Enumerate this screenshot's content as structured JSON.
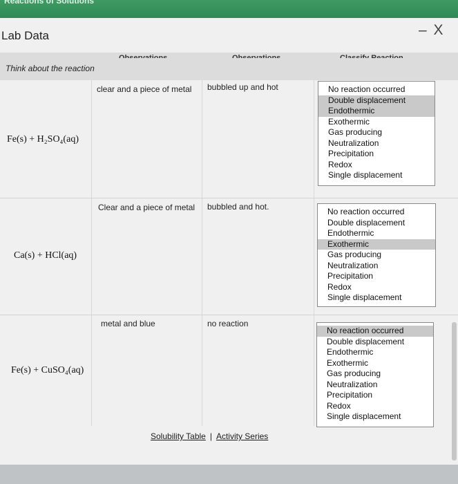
{
  "top_banner": "Reactions of Solutions",
  "window": {
    "title": "Lab Data",
    "close_label": "– X"
  },
  "headers": {
    "obs1": "Observations",
    "obs2": "Observations",
    "classify": "Classify Reaction",
    "think": "Think about the reaction"
  },
  "rows": [
    {
      "reaction": "Fe(s) + H₂SO₄(aq)",
      "obs1": "clear and a piece of metal",
      "obs2": "bubbled up and hot",
      "options": [
        "No reaction occurred",
        "Double displacement",
        "Endothermic",
        "Exothermic",
        "Gas producing",
        "Neutralization",
        "Precipitation",
        "Redox",
        "Single displacement"
      ],
      "selected": [
        "Double displacement",
        "Endothermic"
      ]
    },
    {
      "reaction": "Ca(s) + HCl(aq)",
      "obs1": "Clear and a piece of metal",
      "obs2": "bubbled and hot.",
      "options": [
        "No reaction occurred",
        "Double displacement",
        "Endothermic",
        "Exothermic",
        "Gas producing",
        "Neutralization",
        "Precipitation",
        "Redox",
        "Single displacement"
      ],
      "selected": [
        "Exothermic"
      ]
    },
    {
      "reaction": "Fe(s) + CuSO₄(aq)",
      "obs1": "metal and blue",
      "obs2": "no reaction",
      "options": [
        "No reaction occurred",
        "Double displacement",
        "Endothermic",
        "Exothermic",
        "Gas producing",
        "Neutralization",
        "Precipitation",
        "Redox",
        "Single displacement"
      ],
      "selected": [
        "No reaction occurred"
      ]
    }
  ],
  "links": {
    "solubility": "Solubility Table",
    "separator": "|",
    "activity": "Activity Series"
  }
}
